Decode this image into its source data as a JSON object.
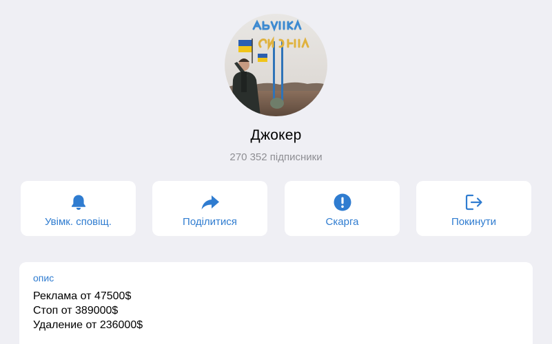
{
  "channel": {
    "name": "Джокер",
    "subscribers": "270 352 підписники",
    "avatar_sign_text": "Авдіївка Україна"
  },
  "actions": [
    {
      "label": "Увімк. сповіщ.",
      "icon": "bell-icon"
    },
    {
      "label": "Поділитися",
      "icon": "share-arrow-icon"
    },
    {
      "label": "Скарга",
      "icon": "exclamation-circle-icon"
    },
    {
      "label": "Покинути",
      "icon": "leave-icon"
    }
  ],
  "description": {
    "heading": "опис",
    "lines": [
      "Реклама от 47500$",
      "Стоп от 389000$",
      "Удаление от 236000$"
    ]
  },
  "colors": {
    "background": "#efeff4",
    "card": "#ffffff",
    "accent": "#2f7cd0",
    "secondary_text": "#8e8e93"
  }
}
